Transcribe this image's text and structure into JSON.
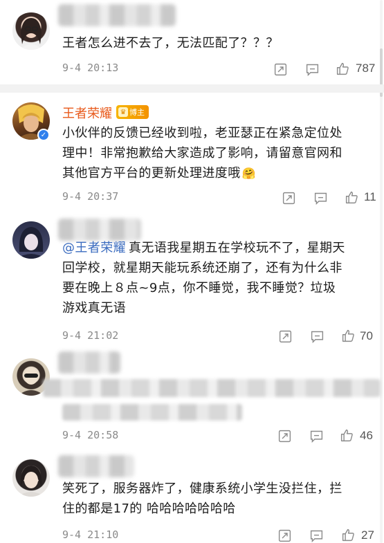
{
  "comments": [
    {
      "text": "王者怎么进不去了，无法匹配了？？？",
      "time": "9-4 20:13",
      "likes": "787"
    },
    {
      "username": "王者荣耀",
      "badge": "博主",
      "text_line1": "小伙伴的反馈已经收到啦，老亚瑟正在紧急定位处",
      "text_line2": "理中！非常抱歉给大家造成了影响，请留意官网和",
      "text_line3": "其他官方平台的更新处理进度哦",
      "emoji": "🤗",
      "time": "9-4 20:37",
      "likes": "11"
    },
    {
      "mention": "@王者荣耀",
      "text_line1": "真无语我星期五在学校玩不了，星期天",
      "text_line2": "回学校，就星期天能玩系统还崩了，还有为什么非",
      "text_line3": "要在晚上８点~9点，你不睡觉，我不睡觉？垃圾",
      "text_line4": "游戏真无语",
      "time": "9-4 21:02",
      "likes": "70"
    },
    {
      "time": "9-4 20:58",
      "likes": "46"
    },
    {
      "text_line1": "笑死了，服务器炸了，健康系统小学生没拦住，拦",
      "text_line2": "住的都是17的 哈哈哈哈哈哈哈",
      "time": "9-4 21:10",
      "likes": "27"
    }
  ],
  "icons": {
    "share": "share-icon",
    "comment": "comment-icon",
    "like": "thumbs-up-icon"
  },
  "colors": {
    "username": "#e8591a",
    "mention": "#3a6bbf",
    "time": "#8a8a8a",
    "divider": "#f2f2f2"
  }
}
